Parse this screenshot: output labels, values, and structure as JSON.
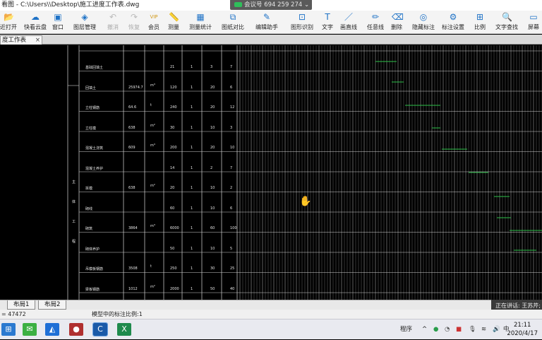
{
  "window": {
    "title": "看图 - C:\\Users\\\\Desktop\\施工进度工作表.dwg"
  },
  "meeting": {
    "label": "会议号 694 259 274",
    "indicator": "⌄"
  },
  "toolbar": {
    "items": [
      {
        "label": "近打开",
        "icon": "folder-icon",
        "glyph": "📂"
      },
      {
        "label": "快看云盘",
        "icon": "cloud-icon",
        "glyph": "☁"
      },
      {
        "label": "窗口",
        "icon": "window-icon",
        "glyph": "▣"
      },
      {
        "label": "图层管理",
        "icon": "layers-icon",
        "glyph": "◈"
      },
      {
        "label": "撤消",
        "icon": "undo-icon",
        "glyph": "↶",
        "disabled": true
      },
      {
        "label": "恢复",
        "icon": "redo-icon",
        "glyph": "↷",
        "disabled": true
      },
      {
        "label": "会员",
        "icon": "vip-icon",
        "glyph": "VIP"
      },
      {
        "label": "测量",
        "icon": "measure-icon",
        "glyph": "📏"
      },
      {
        "label": "测量统计",
        "icon": "measure-stats-icon",
        "glyph": "▦"
      },
      {
        "label": "图纸对比",
        "icon": "compare-icon",
        "glyph": "⧉"
      },
      {
        "label": "编辑助手",
        "icon": "edit-assistant-icon",
        "glyph": "✎"
      },
      {
        "label": "图形识别",
        "icon": "shape-recognize-icon",
        "glyph": "⊡"
      },
      {
        "label": "文字",
        "icon": "text-icon",
        "glyph": "T"
      },
      {
        "label": "画直线",
        "icon": "line-icon",
        "glyph": "／"
      },
      {
        "label": "任意线",
        "icon": "freehand-icon",
        "glyph": "✏"
      },
      {
        "label": "删除",
        "icon": "eraser-icon",
        "glyph": "⌫"
      },
      {
        "label": "隐藏标注",
        "icon": "hide-annotation-icon",
        "glyph": "◎"
      },
      {
        "label": "标注设置",
        "icon": "annotation-settings-icon",
        "glyph": "⚙"
      },
      {
        "label": "比例",
        "icon": "scale-icon",
        "glyph": "⊞"
      },
      {
        "label": "文字查找",
        "icon": "text-search-icon",
        "glyph": "🔍"
      },
      {
        "label": "屏幕",
        "icon": "screen-icon",
        "glyph": "▭"
      }
    ]
  },
  "doc_tab": {
    "label": "度工作表",
    "close": "×"
  },
  "table": {
    "section_label": [
      "主",
      "体",
      "工",
      "程"
    ],
    "rows": [
      {
        "name": "基础回填土",
        "qty": "",
        "unit": "",
        "days": "21",
        "c1": "1",
        "c2": "3",
        "c3": "7"
      },
      {
        "name": "回填土",
        "qty": "25974.7",
        "unit": "m³",
        "days": "120",
        "c1": "1",
        "c2": "20",
        "c3": "6"
      },
      {
        "name": "立柱钢筋",
        "qty": "64.6",
        "unit": "t",
        "days": "240",
        "c1": "1",
        "c2": "20",
        "c3": "12"
      },
      {
        "name": "立柱模",
        "qty": "638",
        "unit": "m²",
        "days": "30",
        "c1": "1",
        "c2": "10",
        "c3": "3"
      },
      {
        "name": "混凝土浇筑",
        "qty": "609",
        "unit": "m³",
        "days": "200",
        "c1": "1",
        "c2": "20",
        "c3": "10"
      },
      {
        "name": "混凝土养护",
        "qty": "",
        "unit": "",
        "days": "14",
        "c1": "1",
        "c2": "2",
        "c3": "7"
      },
      {
        "name": "拆模",
        "qty": "638",
        "unit": "m²",
        "days": "20",
        "c1": "1",
        "c2": "10",
        "c3": "2"
      },
      {
        "name": "砌线",
        "qty": "",
        "unit": "",
        "days": "60",
        "c1": "1",
        "c2": "10",
        "c3": "6"
      },
      {
        "name": "砌筑",
        "qty": "3864",
        "unit": "m³",
        "days": "6000",
        "c1": "1",
        "c2": "60",
        "c3": "100"
      },
      {
        "name": "砌体养护",
        "qty": "",
        "unit": "",
        "days": "50",
        "c1": "1",
        "c2": "10",
        "c3": "5"
      },
      {
        "name": "吊模板钢筋",
        "qty": "3508",
        "unit": "t",
        "days": "250",
        "c1": "1",
        "c2": "30",
        "c3": "25"
      },
      {
        "name": "梁板钢筋",
        "qty": "1012",
        "unit": "m²",
        "days": "2000",
        "c1": "1",
        "c2": "50",
        "c3": "40"
      }
    ]
  },
  "layout_tabs": [
    {
      "label": "布局1"
    },
    {
      "label": "布局2"
    }
  ],
  "status": {
    "coords": "= 47472",
    "scale": "模型中的标注比例:1"
  },
  "speaking": {
    "label": "正在讲话: 王苏芹;"
  },
  "taskbar": {
    "tray_label": "程序",
    "ime": "中",
    "time": "21:11",
    "date": "2020/4/17"
  },
  "colors": {
    "accent": "#1e72c6",
    "grid_line": "#dcdcdc",
    "gantt_bar": "#2ec24a",
    "canvas_bg": "#000000"
  }
}
